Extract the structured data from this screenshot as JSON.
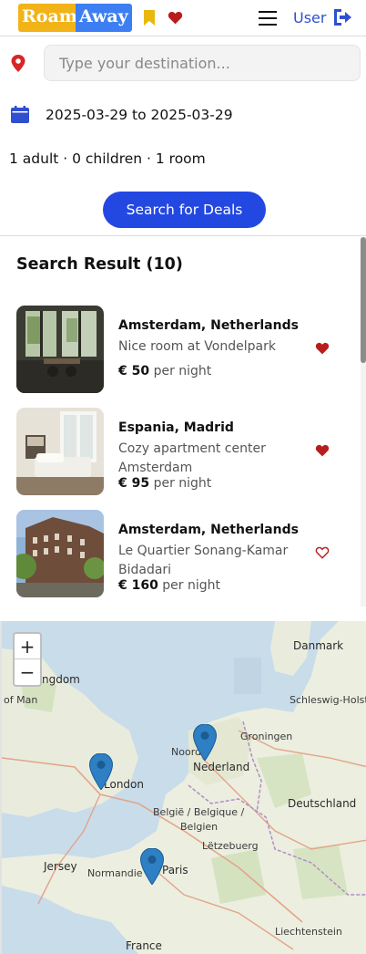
{
  "header": {
    "logo_left": "Roam",
    "logo_right": "Away",
    "user_label": "User",
    "icons": [
      "bookmark-icon",
      "heart-icon",
      "menu-icon",
      "logout-icon"
    ]
  },
  "search": {
    "destination_placeholder": "Type your destination...",
    "destination_value": "",
    "date_range": "2025-03-29 to 2025-03-29",
    "guests": "1 adult  ·  0 children  ·  1 room",
    "button_label": "Search for Deals"
  },
  "results": {
    "title": "Search Result (10)",
    "items": [
      {
        "city": "Amsterdam, Netherlands",
        "name": "Nice room at Vondelpark",
        "price": "€ 50",
        "per": "per night",
        "favorited": true
      },
      {
        "city": "Espania, Madrid",
        "name": "Cozy apartment center Amsterdam",
        "price": "€ 95",
        "per": "per night",
        "favorited": true
      },
      {
        "city": "Amsterdam, Netherlands",
        "name": "Le Quartier Sonang-Kamar Bidadari",
        "price": "€ 160",
        "per": "per night",
        "favorited": false
      }
    ]
  },
  "map": {
    "zoom_in": "+",
    "zoom_out": "−",
    "labels": {
      "kingdom": "ngdom",
      "isle_of_man": "of Man",
      "london": "London",
      "nederland": "Nederland",
      "danmark": "Danmark",
      "deutschland": "Deutschland",
      "belgie": "België / Belgique /",
      "belgien": "Belgien",
      "letzebuerg": "Lëtzebuerg",
      "paris": "Paris",
      "jersey": "Jersey",
      "france": "France",
      "liechtenstein": "Liechtenstein",
      "normandie": "Normandie",
      "groningen": "Groningen",
      "schleswig": "Schleswig-Holstein",
      "noord": "Noord"
    }
  },
  "colors": {
    "accent": "#2348e2",
    "logo_yellow": "#f2b318",
    "logo_blue": "#3d7ff2",
    "heart": "#b91c1c",
    "bookmark": "#e8b80f",
    "link": "#2f4fd0"
  }
}
